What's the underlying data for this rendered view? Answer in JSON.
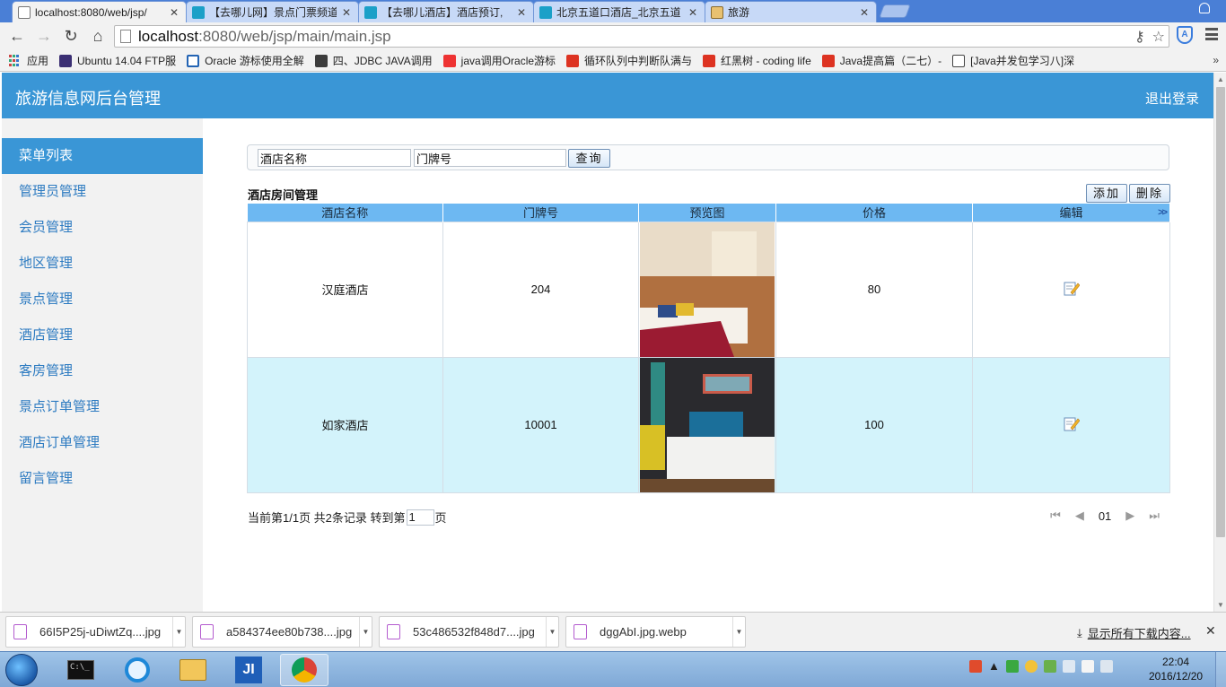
{
  "browser": {
    "tabs": [
      {
        "title": "localhost:8080/web/jsp/",
        "icon": "document-icon",
        "active": true
      },
      {
        "title": "【去哪儿网】景点门票频道",
        "icon": "qunar-icon"
      },
      {
        "title": "【去哪儿酒店】酒店预订,",
        "icon": "qunar-icon"
      },
      {
        "title": "北京五道口酒店_北京五道",
        "icon": "qunar-icon"
      },
      {
        "title": "旅游",
        "icon": "image-icon"
      }
    ],
    "url_host": "localhost",
    "url_path": ":8080/web/jsp/main/main.jsp",
    "bookmarks": [
      {
        "label": "应用",
        "icon": "apps-icon"
      },
      {
        "label": "Ubuntu 14.04 FTP服",
        "icon": "ubuntu-icon"
      },
      {
        "label": "Oracle 游标使用全解",
        "icon": "oracle-icon"
      },
      {
        "label": "四、JDBC JAVA调用",
        "icon": "c-icon"
      },
      {
        "label": "java调用Oracle游标",
        "icon": "baidu-icon"
      },
      {
        "label": "循环队列中判断队满与",
        "icon": "csdn-icon"
      },
      {
        "label": "红黑树 - coding life",
        "icon": "csdn-icon"
      },
      {
        "label": "Java提高篇（二七）-",
        "icon": "csdn-icon"
      },
      {
        "label": "[Java并发包学习八]深",
        "icon": "other-icon"
      }
    ]
  },
  "app": {
    "title": "旅游信息网后台管理",
    "logout": "退出登录",
    "menu_head": "菜单列表",
    "menu": [
      "管理员管理",
      "会员管理",
      "地区管理",
      "景点管理",
      "酒店管理",
      "客房管理",
      "景点订单管理",
      "酒店订单管理",
      "留言管理"
    ]
  },
  "search": {
    "hotel_value": "酒店名称",
    "room_value": "门牌号",
    "query_label": "查询"
  },
  "table": {
    "title": "酒店房间管理",
    "add_label": "添加",
    "delete_label": "删除",
    "columns": [
      "酒店名称",
      "门牌号",
      "预览图",
      "价格",
      "编辑"
    ],
    "rows": [
      {
        "hotel": "汉庭酒店",
        "room": "204",
        "price": "80"
      },
      {
        "hotel": "如家酒店",
        "room": "10001",
        "price": "100"
      }
    ]
  },
  "pager": {
    "summary": "当前第1/1页 共2条记录 转到第",
    "page_value": "1",
    "suffix": "页",
    "current": "01"
  },
  "downloads": {
    "items": [
      "66I5P25j-uDiwtZq....jpg",
      "a584374ee80b738....jpg",
      "53c486532f848d7....jpg",
      "dggAbI.jpg.webp"
    ],
    "show_all": "显示所有下载内容..."
  },
  "taskbar": {
    "time": "22:04",
    "date": "2016/12/20"
  },
  "colors": {
    "header_blue": "#3a96d6",
    "table_head": "#6db8f2",
    "alt_row": "#d3f3fb",
    "menu_text": "#2d7bc1"
  }
}
